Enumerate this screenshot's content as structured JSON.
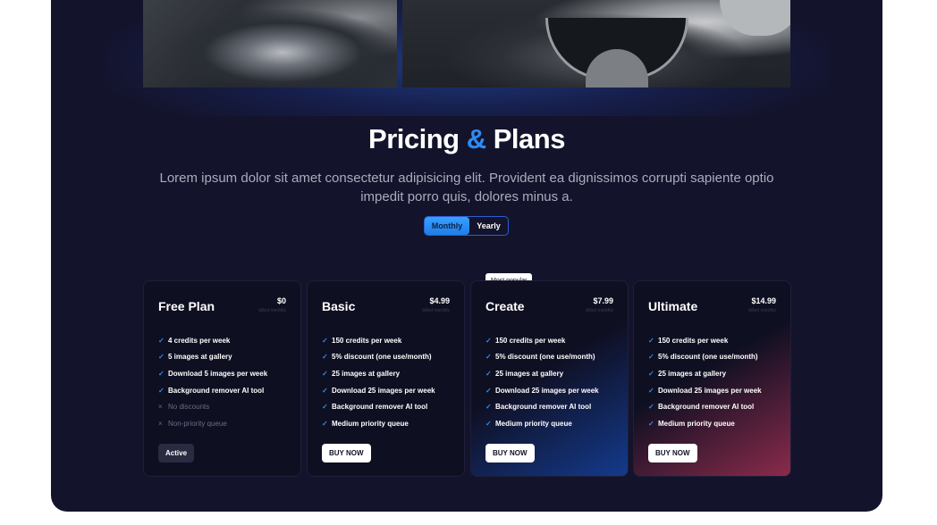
{
  "header": {
    "title_part1": "Pricing",
    "title_amp": "&",
    "title_part2": "Plans",
    "subtitle": "Lorem ipsum dolor sit amet consectetur adipisicing elit. Provident ea dignissimos corrupti sapiente optio impedit porro quis, dolores minus a."
  },
  "toggle": {
    "monthly": "Monthly",
    "yearly": "Yearly",
    "selected": "Monthly"
  },
  "badge": "Most popular",
  "colors": {
    "panel": "#13132b",
    "accent": "#2e8bf0",
    "create_gradient": "#143a8c",
    "ultimate_gradient": "#8a2b4b"
  },
  "plans": [
    {
      "name": "Free Plan",
      "price": "$0",
      "billed": "billed monthly",
      "button": "Active",
      "features": [
        {
          "text": "4 credits per week",
          "icon": "check-icon"
        },
        {
          "text": "5 images at gallery",
          "icon": "check-icon"
        },
        {
          "text": "Download 5 images per week",
          "icon": "check-icon"
        },
        {
          "text": "Background remover AI tool",
          "icon": "check-icon"
        },
        {
          "text": "No discounts",
          "icon": "x-icon"
        },
        {
          "text": "Non-priority queue",
          "icon": "x-icon"
        }
      ]
    },
    {
      "name": "Basic",
      "price": "$4.99",
      "billed": "billed monthly",
      "button": "BUY NOW",
      "features": [
        {
          "text": "150 credits per week",
          "icon": "check-icon"
        },
        {
          "text": "5% discount (one use/month)",
          "icon": "check-icon"
        },
        {
          "text": "25 images at gallery",
          "icon": "check-icon"
        },
        {
          "text": "Download 25 images per week",
          "icon": "check-icon"
        },
        {
          "text": "Background remover AI tool",
          "icon": "check-icon"
        },
        {
          "text": "Medium priority queue",
          "icon": "check-icon"
        }
      ]
    },
    {
      "name": "Create",
      "price": "$7.99",
      "billed": "billed monthly",
      "button": "BUY NOW",
      "features": [
        {
          "text": "150 credits per week",
          "icon": "check-icon"
        },
        {
          "text": "5% discount (one use/month)",
          "icon": "check-icon"
        },
        {
          "text": "25 images at gallery",
          "icon": "check-icon"
        },
        {
          "text": "Download 25 images per week",
          "icon": "check-icon"
        },
        {
          "text": "Background remover AI tool",
          "icon": "check-icon"
        },
        {
          "text": "Medium priority queue",
          "icon": "check-icon"
        }
      ]
    },
    {
      "name": "Ultimate",
      "price": "$14.99",
      "billed": "billed monthly",
      "button": "BUY NOW",
      "features": [
        {
          "text": "150 credits per week",
          "icon": "check-icon"
        },
        {
          "text": "5% discount (one use/month)",
          "icon": "check-icon"
        },
        {
          "text": "25 images at gallery",
          "icon": "check-icon"
        },
        {
          "text": "Download 25 images per week",
          "icon": "check-icon"
        },
        {
          "text": "Background remover AI tool",
          "icon": "check-icon"
        },
        {
          "text": "Medium priority queue",
          "icon": "check-icon"
        }
      ]
    }
  ]
}
